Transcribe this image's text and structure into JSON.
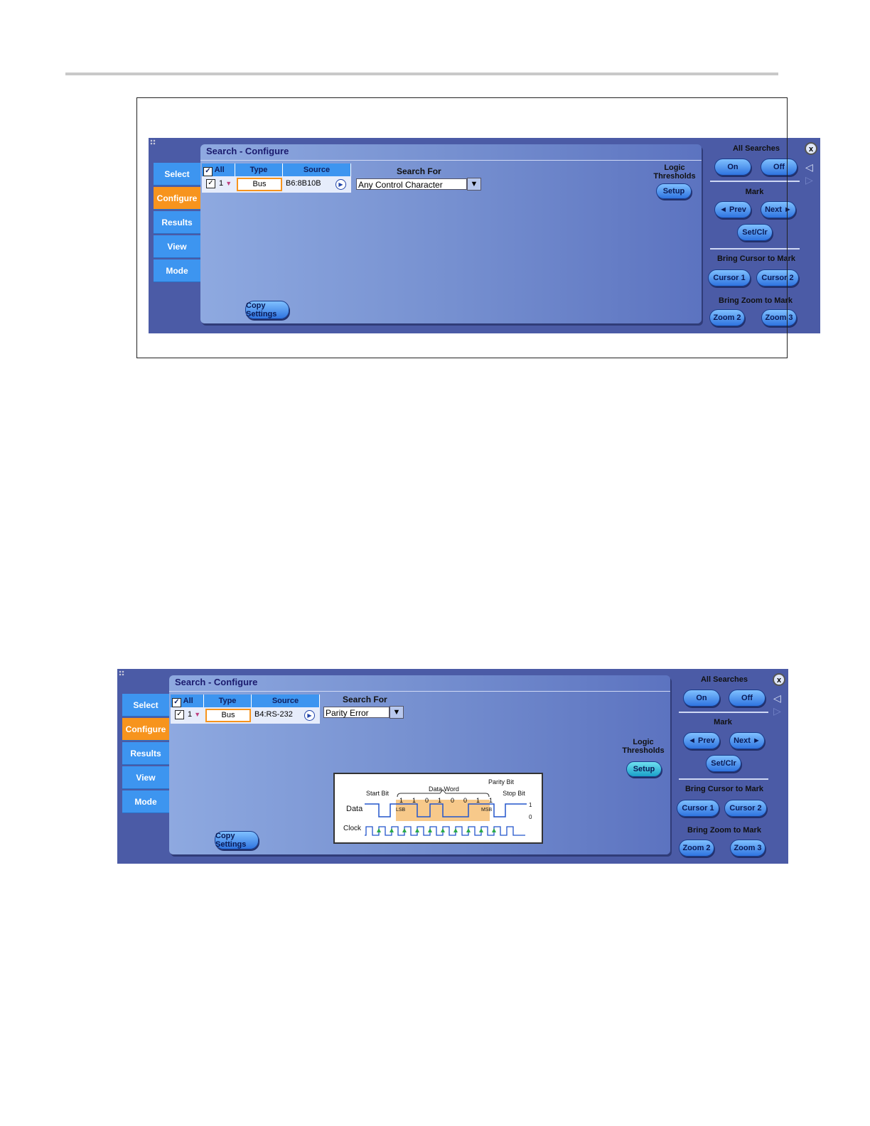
{
  "panels": [
    {
      "title": "Search - Configure",
      "tabs": [
        "Select",
        "Configure",
        "Results",
        "View",
        "Mode"
      ],
      "active_tab": "Configure",
      "table": {
        "all_label": "All",
        "headers": [
          "Type",
          "Source"
        ],
        "row": {
          "index": "1",
          "type": "Bus",
          "source": "B6:8B10B"
        }
      },
      "search_for_label": "Search For",
      "search_for_value": "Any Control Character",
      "logic_thresholds_label": "Logic Thresholds",
      "setup_label": "Setup",
      "copy_settings_label": "Copy Settings",
      "right": {
        "all_searches": "All Searches",
        "on": "On",
        "off": "Off",
        "mark": "Mark",
        "prev": "◄ Prev",
        "next": "Next ►",
        "setclr": "Set/Clr",
        "bring_cursor": "Bring Cursor to Mark",
        "cursor1": "Cursor 1",
        "cursor2": "Cursor 2",
        "bring_zoom": "Bring Zoom to Mark",
        "zoom2": "Zoom 2",
        "zoom3": "Zoom 3",
        "close": "x"
      }
    },
    {
      "title": "Search - Configure",
      "tabs": [
        "Select",
        "Configure",
        "Results",
        "View",
        "Mode"
      ],
      "active_tab": "Configure",
      "table": {
        "all_label": "All",
        "headers": [
          "Type",
          "Source"
        ],
        "row": {
          "index": "1",
          "type": "Bus",
          "source": "B4:RS-232"
        }
      },
      "search_for_label": "Search For",
      "search_for_value": "Parity Error",
      "logic_thresholds_label": "Logic Thresholds",
      "setup_label": "Setup",
      "copy_settings_label": "Copy Settings",
      "right": {
        "all_searches": "All Searches",
        "on": "On",
        "off": "Off",
        "mark": "Mark",
        "prev": "◄ Prev",
        "next": "Next ►",
        "setclr": "Set/Clr",
        "bring_cursor": "Bring Cursor to Mark",
        "cursor1": "Cursor 1",
        "cursor2": "Cursor 2",
        "bring_zoom": "Bring Zoom to Mark",
        "zoom2": "Zoom 2",
        "zoom3": "Zoom 3",
        "close": "x"
      },
      "diagram": {
        "data_word": "Data Word",
        "parity_bit": "Parity Bit",
        "start_bit": "Start Bit",
        "stop_bit": "Stop Bit",
        "data": "Data",
        "clock": "Clock",
        "lsb": "LSB",
        "msb": "MSB",
        "bits": [
          "1",
          "1",
          "0",
          "1",
          "0",
          "0",
          "1",
          "1"
        ],
        "one": "1",
        "zero": "0"
      }
    }
  ]
}
